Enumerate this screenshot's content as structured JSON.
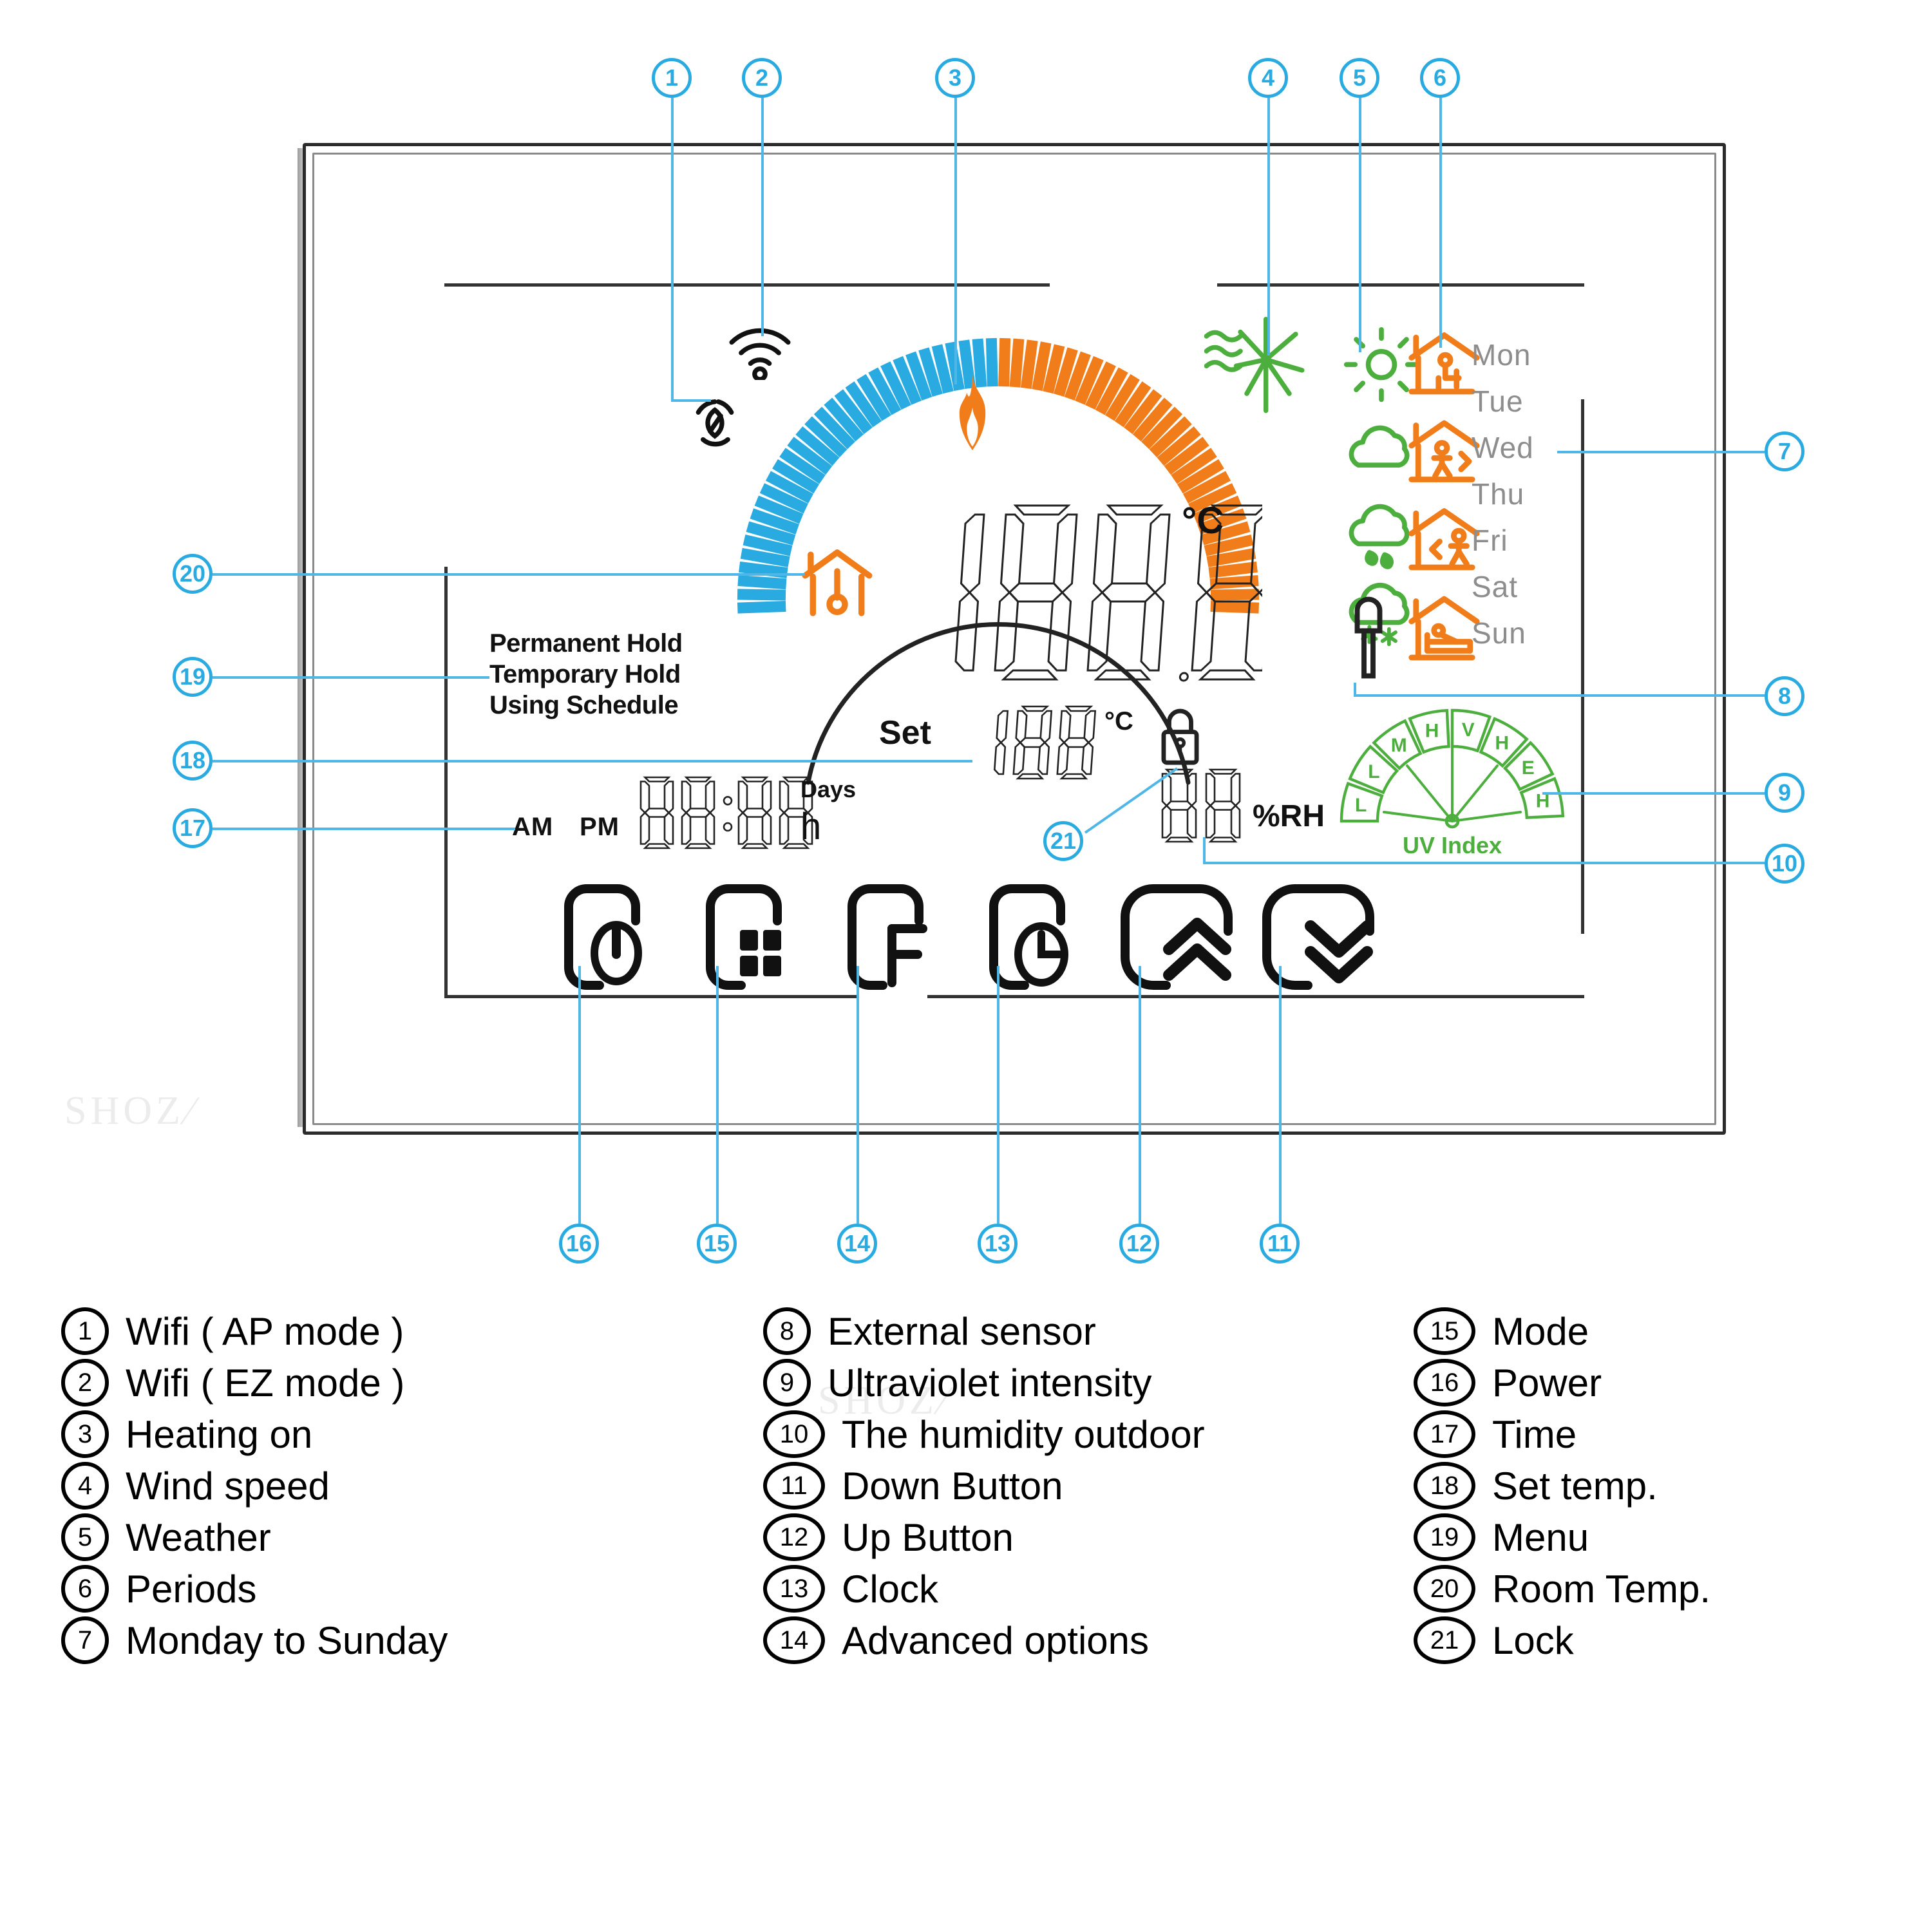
{
  "device": {
    "modes": [
      "Permanent Hold",
      "Temporary Hold",
      "Using Schedule"
    ],
    "big_temp": "188.8",
    "big_temp_unit": "°C",
    "set_label": "Set",
    "set_temp": "188",
    "set_temp_unit": "°C",
    "time": {
      "am": "AM",
      "pm": "PM",
      "value": "88:88",
      "days_label": "Days",
      "hour_label": "h"
    },
    "humidity": {
      "value": "88",
      "unit": "%RH"
    },
    "uv": {
      "title": "UV Index",
      "segments": [
        "L",
        "L",
        "M",
        "H",
        "V",
        "H",
        "E",
        "H"
      ]
    },
    "weekdays": [
      "Mon",
      "Tue",
      "Wed",
      "Thu",
      "Fri",
      "Sat",
      "Sun"
    ],
    "icons": {
      "wifi_ap": "wifi-ap-icon",
      "wifi_ez": "wifi-ez-icon",
      "flame": "flame-icon",
      "wind": "wind-speed-icon",
      "sun": "sun-icon",
      "cloud": "cloud-icon",
      "rain": "rain-icon",
      "snow": "snow-icon",
      "probe": "external-sensor-icon",
      "room_temp": "room-temp-house-icon",
      "lock": "lock-icon",
      "period_sit": "period-home-sitting-icon",
      "period_walk_out": "period-leaving-icon",
      "period_walk_in": "period-returning-icon",
      "period_sleep": "period-sleeping-icon"
    },
    "buttons": [
      {
        "name": "power-button",
        "glyph": "power"
      },
      {
        "name": "mode-button",
        "glyph": "grid"
      },
      {
        "name": "function-button",
        "glyph": "F"
      },
      {
        "name": "clock-button",
        "glyph": "clock"
      },
      {
        "name": "up-button",
        "glyph": "chevrons-up"
      },
      {
        "name": "down-button",
        "glyph": "chevrons-down"
      }
    ]
  },
  "callouts": {
    "top": [
      "1",
      "2",
      "3",
      "4",
      "5",
      "6"
    ],
    "right": [
      "7",
      "8",
      "9",
      "10"
    ],
    "left": [
      "20",
      "19",
      "18",
      "17"
    ],
    "inner": [
      "21"
    ],
    "bottom": [
      "16",
      "15",
      "14",
      "13",
      "12",
      "11"
    ]
  },
  "legend": {
    "col1": [
      {
        "n": "1",
        "text": "Wifi ( AP mode )"
      },
      {
        "n": "2",
        "text": "Wifi ( EZ mode )"
      },
      {
        "n": "3",
        "text": "Heating on"
      },
      {
        "n": "4",
        "text": "Wind speed"
      },
      {
        "n": "5",
        "text": "Weather"
      },
      {
        "n": "6",
        "text": "Periods"
      },
      {
        "n": "7",
        "text": "Monday to Sunday"
      }
    ],
    "col2": [
      {
        "n": "8",
        "text": "External sensor"
      },
      {
        "n": "9",
        "text": "Ultraviolet intensity"
      },
      {
        "n": "10",
        "text": "The humidity outdoor"
      },
      {
        "n": "11",
        "text": "Down Button"
      },
      {
        "n": "12",
        "text": "Up Button"
      },
      {
        "n": "13",
        "text": "Clock"
      },
      {
        "n": "14",
        "text": "Advanced options"
      }
    ],
    "col3": [
      {
        "n": "15",
        "text": "Mode"
      },
      {
        "n": "16",
        "text": "Power"
      },
      {
        "n": "17",
        "text": "Time"
      },
      {
        "n": "18",
        "text": "Set temp."
      },
      {
        "n": "19",
        "text": "Menu"
      },
      {
        "n": "20",
        "text": "Room Temp."
      },
      {
        "n": "21",
        "text": "Lock"
      }
    ]
  },
  "watermark": {
    "text": "SHOZ"
  },
  "colors": {
    "callout": "#29abe2",
    "arc_cool": "#29abe2",
    "arc_heat": "#f07d1a",
    "orange": "#f07d1a",
    "green": "#4caf3d",
    "grey_text": "#8d8d8d"
  }
}
